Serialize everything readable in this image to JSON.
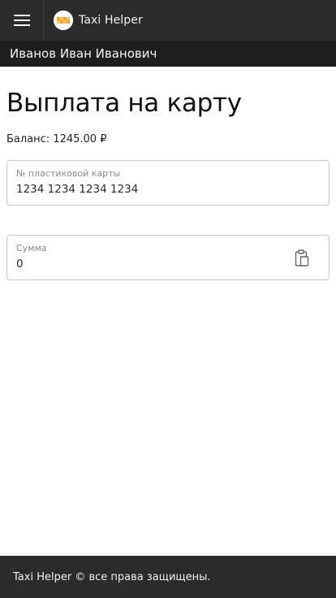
{
  "header": {
    "menu_icon": "hamburger-icon",
    "logo_icon": "taxi-checker-logo",
    "brand": "Taxi Helper",
    "colors": {
      "bar": "#2b2b2b",
      "logo_accent": "#f5a623"
    }
  },
  "user": {
    "name": "Иванов Иван Иванович"
  },
  "page": {
    "title": "Выплата на карту",
    "balance": "Баланс: 1245.00 ₽"
  },
  "form": {
    "card": {
      "label": "№ пластиковой карты",
      "value": "1234 1234 1234 1234"
    },
    "amount": {
      "label": "Сумма",
      "value": "0",
      "action_icon": "clipboard-icon"
    }
  },
  "footer": {
    "text": "Taxi Helper © все права защищены."
  }
}
